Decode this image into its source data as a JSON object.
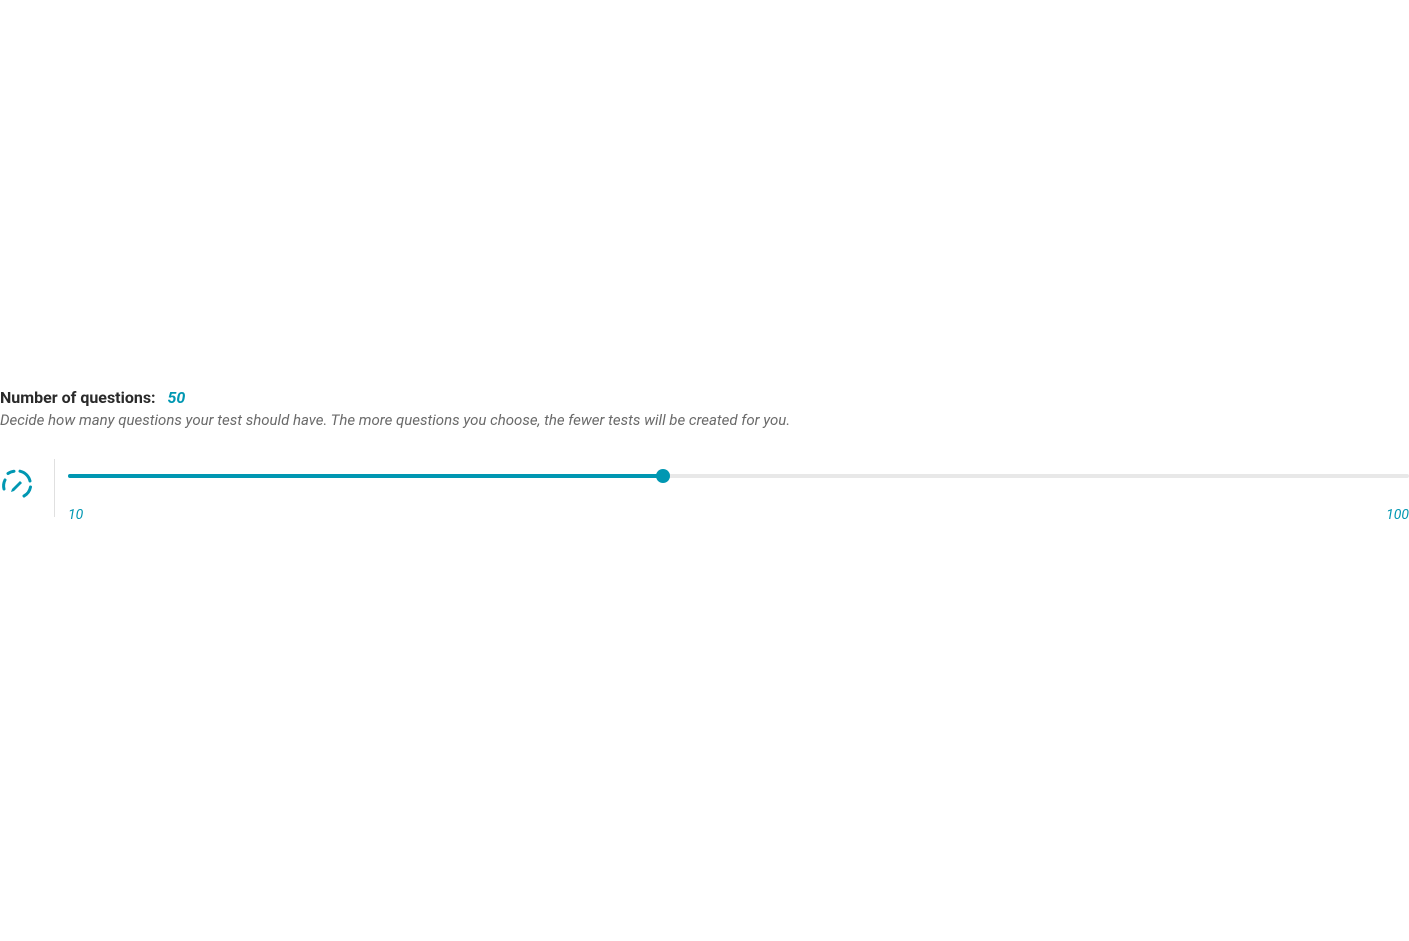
{
  "questions": {
    "title_label": "Number of questions:",
    "current_value": "50",
    "description": "Decide how many questions your test should have. The more questions you choose, the fewer tests will be created for you.",
    "slider": {
      "min": 10,
      "max": 100,
      "value": 50,
      "min_label": "10",
      "max_label": "100",
      "fill_percent": 44.4
    }
  },
  "colors": {
    "accent": "#0097b2",
    "text_dark": "#2a2a2a",
    "text_muted": "#6a6a6a",
    "track_bg": "#e8e8e8"
  }
}
